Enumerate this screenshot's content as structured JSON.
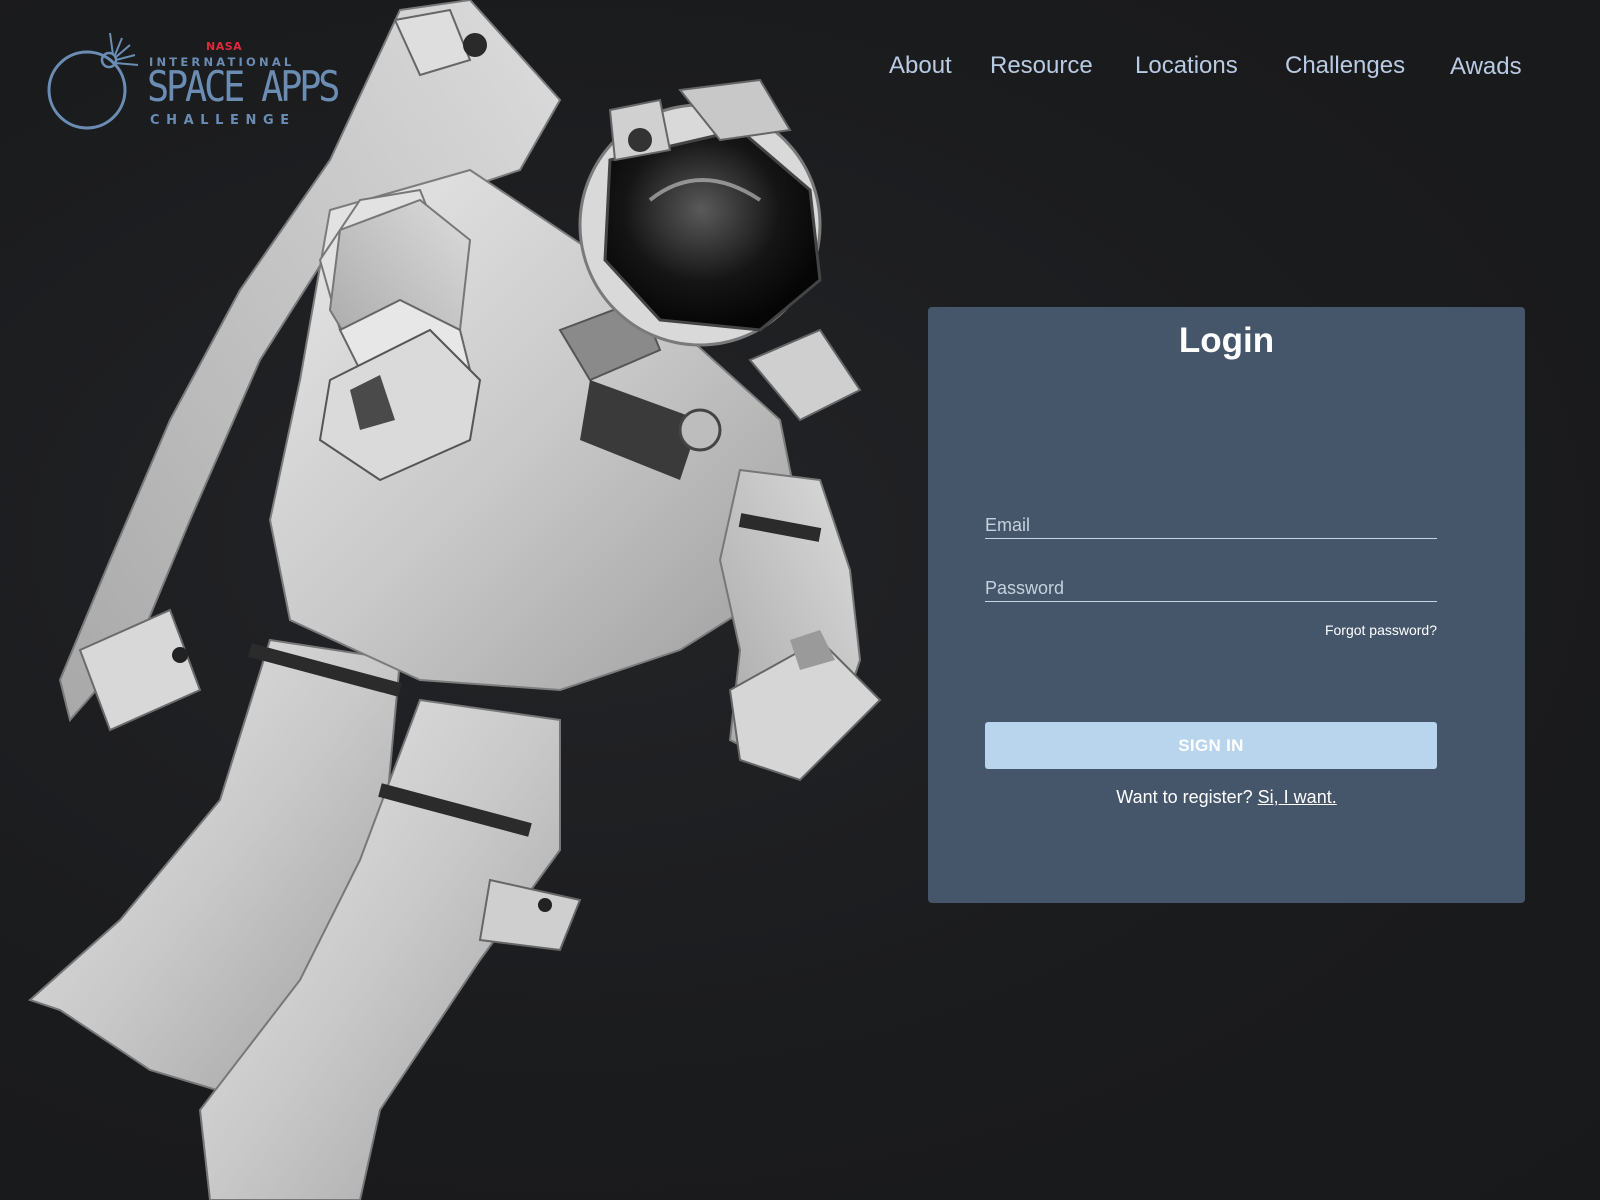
{
  "brand": {
    "nasa": "NASA",
    "line1": "INTERNATIONAL",
    "line2": "SPACE APPS",
    "line3": "CHALLENGE",
    "colors": {
      "nasa_red": "#e0293a",
      "logo_blue": "#6b8db4"
    }
  },
  "nav": {
    "items": [
      {
        "label": "About"
      },
      {
        "label": "Resource"
      },
      {
        "label": "Locations"
      },
      {
        "label": "Challenges"
      },
      {
        "label": "Awads"
      }
    ]
  },
  "login": {
    "title": "Login",
    "email_placeholder": "Email",
    "password_placeholder": "Password",
    "email_value": "",
    "password_value": "",
    "forgot_label": "Forgot password?",
    "signin_label": "SIGN IN",
    "register_prompt": "Want to register?",
    "register_link": "Si, I want."
  },
  "colors": {
    "background": "#1b1c1e",
    "card": "#45566b",
    "button": "#b9d5ee",
    "nav_text": "#b9cbe3"
  },
  "icons": {
    "logo": "space-apps-orbit-logo",
    "hero": "astronaut-illustration"
  }
}
